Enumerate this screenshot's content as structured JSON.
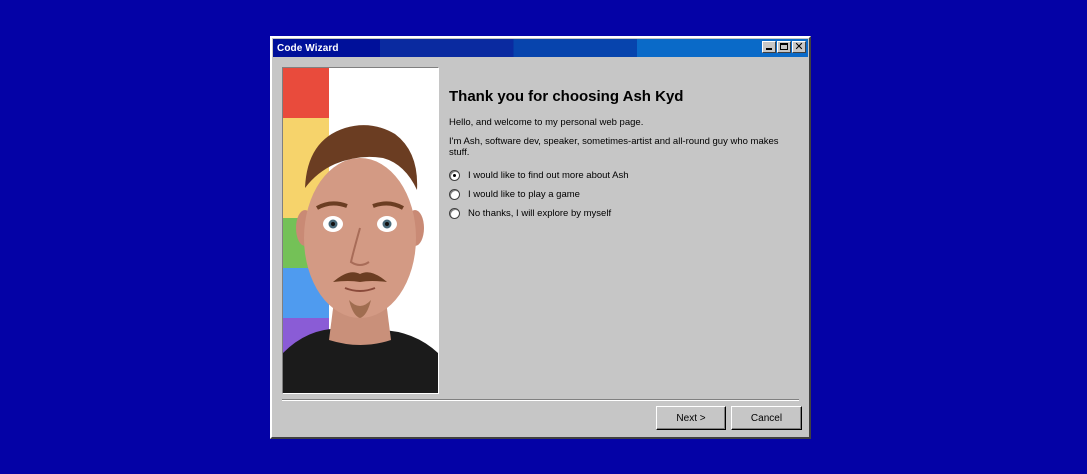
{
  "window": {
    "title": "Code Wizard",
    "buttons": [
      "minimize",
      "maximize",
      "close"
    ]
  },
  "photo": {
    "description_icon": "person-photo",
    "stripe_colors": [
      "#e94b3c",
      "#f6d36b",
      "#74c157",
      "#4f9bef",
      "#8a5cd6"
    ]
  },
  "content": {
    "heading": "Thank you for choosing Ash Kyd",
    "paragraphs": [
      "Hello, and welcome to my personal web page.",
      "I'm Ash, software dev, speaker, sometimes-artist and all-round guy who makes stuff."
    ],
    "options": [
      {
        "label": "I would like to find out more about Ash",
        "selected": true
      },
      {
        "label": "I would like to play a game",
        "selected": false
      },
      {
        "label": "No thanks, I will explore by myself",
        "selected": false
      }
    ]
  },
  "footer": {
    "next_label": "Next >",
    "cancel_label": "Cancel"
  },
  "colors": {
    "desktop": "#0402a6",
    "window_face": "#c6c6c6",
    "titlebar_start": "#00109a",
    "titlebar_end": "#0a6ac8"
  }
}
